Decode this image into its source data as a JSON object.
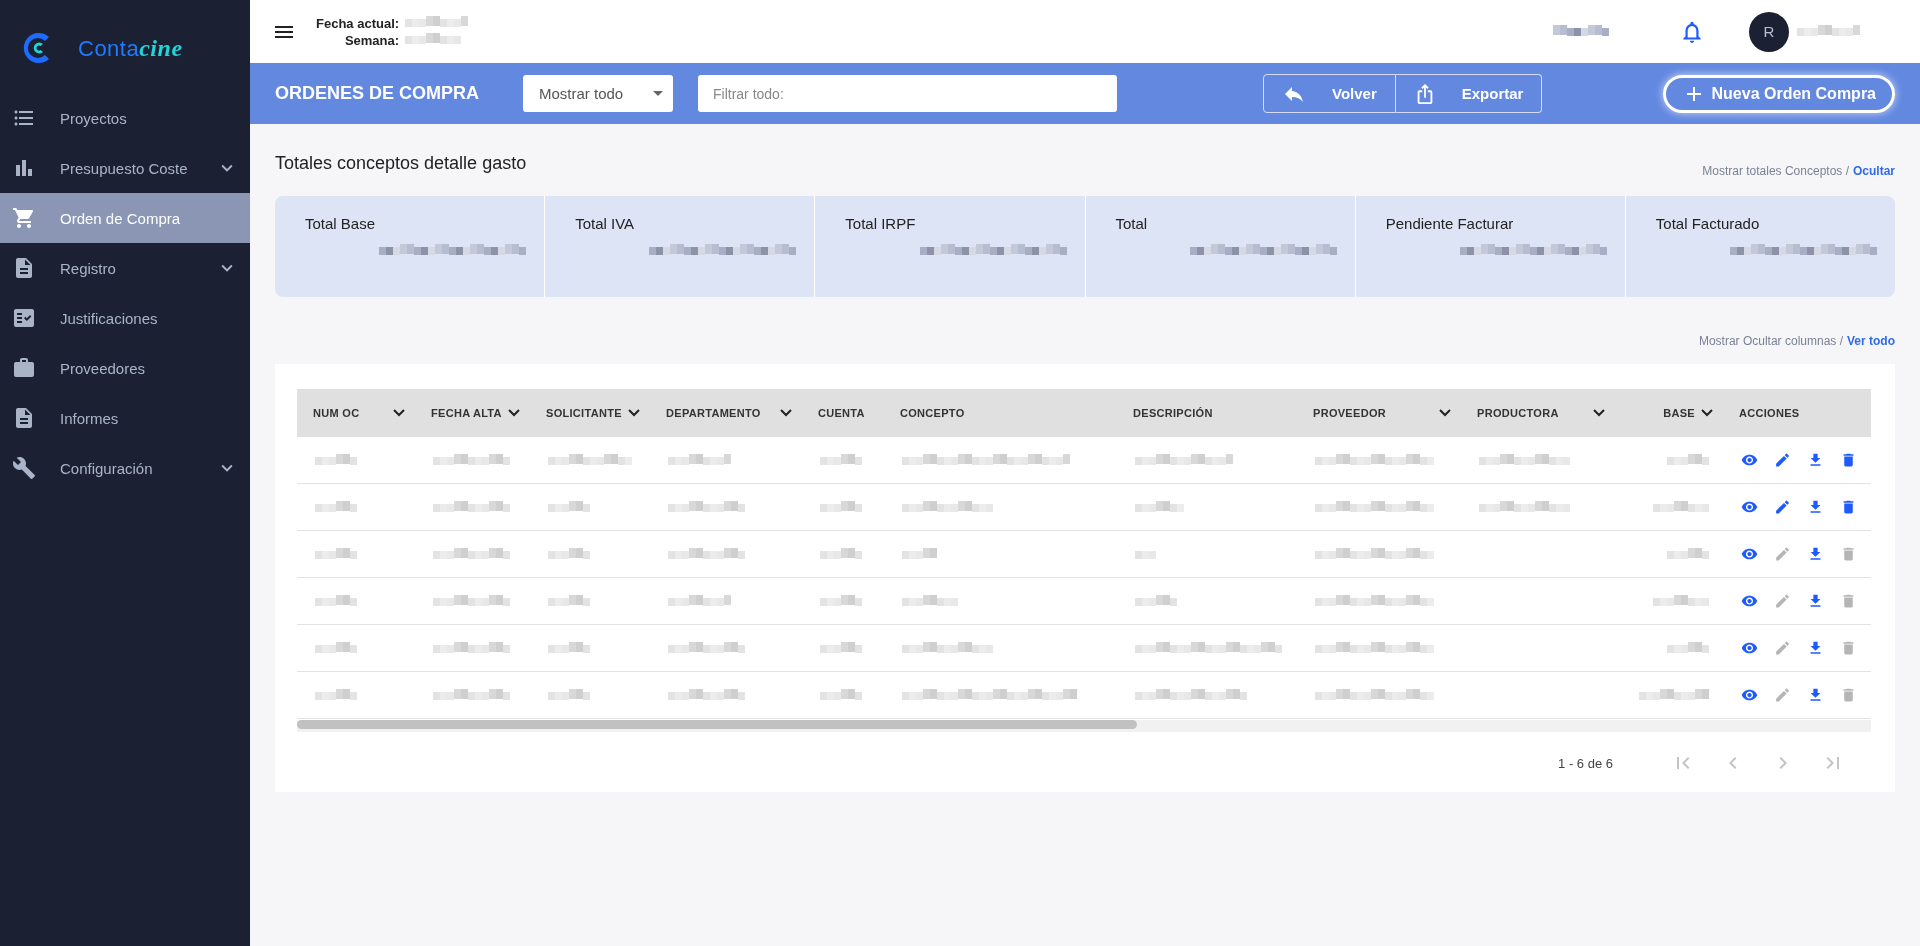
{
  "logo": {
    "text": "Conta",
    "accent": "cine"
  },
  "sidebar": {
    "items": [
      {
        "label": "Proyectos",
        "selected": false,
        "expandable": false
      },
      {
        "label": "Presupuesto Coste",
        "selected": false,
        "expandable": true
      },
      {
        "label": "Orden de Compra",
        "selected": true,
        "expandable": false
      },
      {
        "label": "Registro",
        "selected": false,
        "expandable": true
      },
      {
        "label": "Justificaciones",
        "selected": false,
        "expandable": false
      },
      {
        "label": "Proveedores",
        "selected": false,
        "expandable": false
      },
      {
        "label": "Informes",
        "selected": false,
        "expandable": false
      },
      {
        "label": "Configuración",
        "selected": false,
        "expandable": true
      }
    ]
  },
  "header": {
    "date_label": "Fecha actual:",
    "week_label": "Semana:",
    "avatar": "R"
  },
  "toolbar": {
    "title": "ORDENES DE COMPRA",
    "filter_select": "Mostrar todo",
    "search": {
      "placeholder": "Filtrar todo:"
    },
    "buttons": [
      "Volver",
      "Exportar"
    ],
    "primary_button": "Nueva Orden Compra"
  },
  "totals": {
    "heading": "Totales conceptos detalle gasto",
    "toggle_label": "Mostrar totales Conceptos /",
    "toggle_link": "Ocultar",
    "cards": [
      {
        "label": "Total Base"
      },
      {
        "label": "Total IVA"
      },
      {
        "label": "Total IRPF"
      },
      {
        "label": "Total"
      },
      {
        "label": "Pendiente Facturar"
      },
      {
        "label": "Total Facturado"
      }
    ]
  },
  "columns_toggle": {
    "label": "Mostrar Ocultar columnas /",
    "link": "Ver todo"
  },
  "table": {
    "columns": [
      {
        "label": "NUM OC",
        "sortable": true
      },
      {
        "label": "FECHA ALTA",
        "sortable": true
      },
      {
        "label": "SOLICITANTE",
        "sortable": true
      },
      {
        "label": "DEPARTAMENTO",
        "sortable": true
      },
      {
        "label": "CUENTA",
        "sortable": false
      },
      {
        "label": "CONCEPTO",
        "sortable": false
      },
      {
        "label": "DESCRIPCIÓN",
        "sortable": false
      },
      {
        "label": "PROVEEDOR",
        "sortable": true
      },
      {
        "label": "PRODUCTORA",
        "sortable": true
      },
      {
        "label": "BASE",
        "sortable": true
      },
      {
        "label": "ACCIONES",
        "sortable": false
      }
    ],
    "rows": [
      {
        "editable": true
      },
      {
        "editable": true
      },
      {
        "editable": false
      },
      {
        "editable": false
      },
      {
        "editable": false
      },
      {
        "editable": false
      }
    ]
  },
  "pagination": {
    "range": "1 - 6 de 6",
    "buttons": [
      {
        "disabled": true
      },
      {
        "disabled": true
      },
      {
        "disabled": true
      },
      {
        "disabled": true
      }
    ]
  }
}
